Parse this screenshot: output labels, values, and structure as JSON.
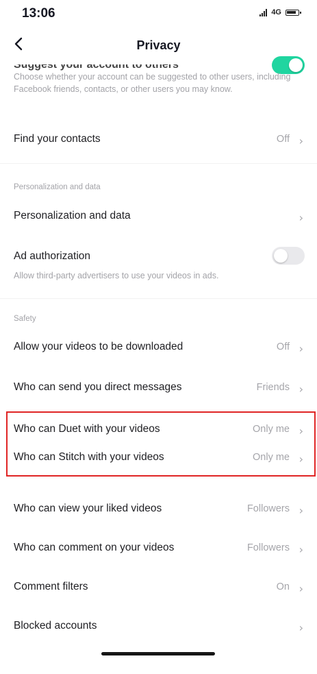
{
  "status": {
    "time": "13:06",
    "network": "4G"
  },
  "header": {
    "title": "Privacy"
  },
  "suggest": {
    "label": "Suggest your account to others",
    "toggle_on": true,
    "description": "Choose whether your account can be suggested to other users, including Facebook friends, contacts, or other users you may know."
  },
  "find_contacts": {
    "label": "Find your contacts",
    "value": "Off"
  },
  "personalization": {
    "section": "Personalization and data",
    "item": {
      "label": "Personalization and data",
      "value": ""
    }
  },
  "ad_auth": {
    "label": "Ad authorization",
    "toggle_on": false,
    "description": "Allow third-party advertisers to use your videos in ads."
  },
  "safety": {
    "section": "Safety",
    "items": [
      {
        "label": "Allow your videos to be downloaded",
        "value": "Off"
      },
      {
        "label": "Who can send you direct messages",
        "value": "Friends"
      },
      {
        "label": "Who can Duet with your videos",
        "value": "Only me"
      },
      {
        "label": "Who can Stitch with your videos",
        "value": "Only me"
      },
      {
        "label": "Who can view your liked videos",
        "value": "Followers"
      },
      {
        "label": "Who can comment on your videos",
        "value": "Followers"
      },
      {
        "label": "Comment filters",
        "value": "On"
      },
      {
        "label": "Blocked accounts",
        "value": ""
      }
    ]
  },
  "colors": {
    "toggle_on": "#20d5a0",
    "highlight": "#e02424"
  },
  "icons": {
    "back": "chevron-left-icon",
    "row_arrow": "chevron-right-icon"
  }
}
